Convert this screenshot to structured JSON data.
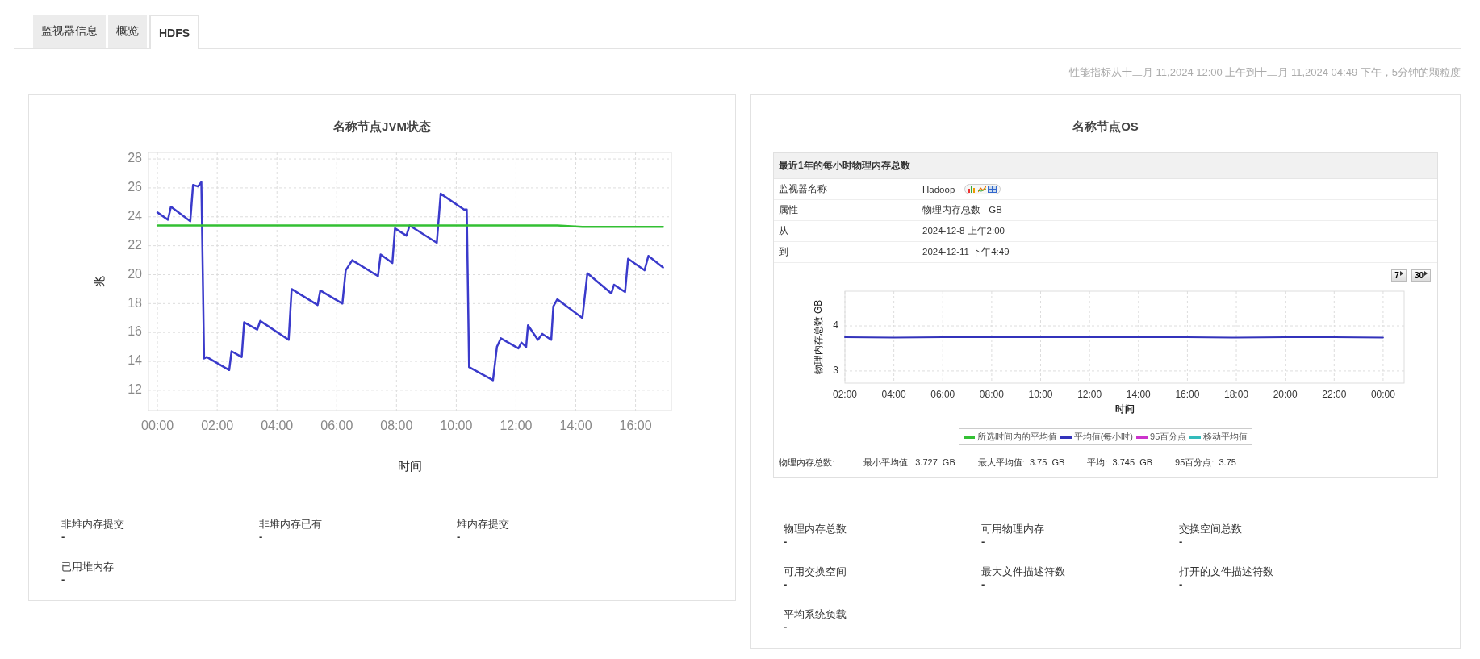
{
  "tabs": [
    {
      "label": "监视器信息",
      "selected": false
    },
    {
      "label": "概览",
      "selected": false
    },
    {
      "label": "HDFS",
      "selected": true
    }
  ],
  "period_note": "性能指标从十二月 11,2024 12:00 上午到十二月 11,2024 04:49 下午，5分钟的颗粒度",
  "jvm_panel": {
    "title": "名称节点JVM状态",
    "chart_data": {
      "type": "line",
      "xlabel": "时间",
      "ylabel": "兆",
      "x": [
        0,
        0.35,
        0.45,
        1.1,
        1.19,
        1.36,
        1.47,
        1.56,
        1.65,
        2.4,
        2.48,
        2.82,
        2.9,
        3.34,
        3.44,
        4.39,
        4.49,
        5.36,
        5.45,
        6.19,
        6.3,
        6.52,
        7.38,
        7.47,
        7.86,
        7.95,
        8.33,
        8.44,
        9.35,
        9.48,
        10.26,
        10.35,
        10.43,
        11.23,
        11.36,
        11.49,
        12.08,
        12.18,
        12.34,
        12.4,
        12.73,
        12.88,
        13.18,
        13.25,
        13.38,
        14.22,
        14.39,
        15.19,
        15.28,
        15.65,
        15.75,
        16.3,
        16.43,
        16.92
      ],
      "series": [
        {
          "color": "#3a3acb",
          "values": [
            24.3,
            23.8,
            24.7,
            23.7,
            26.2,
            26.1,
            26.4,
            14.2,
            14.3,
            13.4,
            14.7,
            14.3,
            16.7,
            16.2,
            16.8,
            15.5,
            19.0,
            17.9,
            18.9,
            18.0,
            20.3,
            21.0,
            19.9,
            21.4,
            20.8,
            23.2,
            22.7,
            23.4,
            22.2,
            25.6,
            24.5,
            24.5,
            13.6,
            12.7,
            15.0,
            15.6,
            14.9,
            15.3,
            15.0,
            16.5,
            15.5,
            15.9,
            15.5,
            17.8,
            18.3,
            17.0,
            20.1,
            18.7,
            19.3,
            18.8,
            21.1,
            20.3,
            21.3,
            20.5
          ]
        },
        {
          "color": "#33c033",
          "values": [
            23.4,
            23.4,
            23.4,
            23.4,
            23.4,
            23.4,
            23.4,
            23.4,
            23.4,
            23.4,
            23.4,
            23.4,
            23.4,
            23.4,
            23.4,
            23.4,
            23.4,
            23.4,
            23.4,
            23.4,
            23.4,
            23.4,
            23.4,
            23.4,
            23.4,
            23.4,
            23.4,
            23.4,
            23.4,
            23.4,
            23.4,
            23.4,
            23.4,
            23.4,
            23.4,
            23.4,
            23.4,
            23.4,
            23.4,
            23.4,
            23.4,
            23.4,
            23.4,
            23.4,
            23.4,
            23.3,
            23.3,
            23.3,
            23.3,
            23.3,
            23.3,
            23.3,
            23.3,
            23.3
          ]
        }
      ],
      "xlim": [
        -0.3,
        17.2
      ],
      "ylim": [
        10.6,
        28.45
      ],
      "xticks": [
        {
          "value": 0,
          "label": "00:00"
        },
        {
          "value": 2,
          "label": "02:00"
        },
        {
          "value": 4,
          "label": "04:00"
        },
        {
          "value": 6,
          "label": "06:00"
        },
        {
          "value": 8,
          "label": "08:00"
        },
        {
          "value": 10,
          "label": "10:00"
        },
        {
          "value": 12,
          "label": "12:00"
        },
        {
          "value": 14,
          "label": "14:00"
        },
        {
          "value": 16,
          "label": "16:00"
        }
      ],
      "yticks": [
        12,
        14,
        16,
        18,
        20,
        22,
        24,
        26,
        28
      ],
      "grid": true
    },
    "metrics": [
      {
        "label": "非堆内存提交",
        "value": "-"
      },
      {
        "label": "非堆内存已有",
        "value": "-"
      },
      {
        "label": "堆内存提交",
        "value": "-"
      },
      {
        "label": "已用堆内存",
        "value": "-"
      }
    ]
  },
  "os_panel": {
    "title": "名称节点OS",
    "report": {
      "header": "最近1年的每小时物理内存总数",
      "rows": [
        {
          "label": "监视器名称",
          "value": "Hadoop",
          "kind": "monitor"
        },
        {
          "label": "属性",
          "value": "物理内存总数 - GB",
          "kind": "text"
        },
        {
          "label": "从",
          "value": "2024-12-8 上午2:00",
          "kind": "text"
        },
        {
          "label": "到",
          "value": "2024-12-11 下午4:49",
          "kind": "text"
        }
      ],
      "range_buttons": [
        "7",
        "30"
      ],
      "chart_data": {
        "type": "line",
        "xlabel": "时间",
        "ylabel": "物理内存总数 GB",
        "categories": [
          "02:00",
          "04:00",
          "06:00",
          "08:00",
          "10:00",
          "12:00",
          "14:00",
          "16:00",
          "18:00",
          "20:00",
          "22:00",
          "00:00"
        ],
        "series": [
          {
            "name": "所选时间内的平均值",
            "color": "#33c033",
            "values": [
              null,
              null,
              null,
              null,
              null,
              null,
              null,
              null,
              null,
              null,
              null,
              null
            ]
          },
          {
            "name": "平均值(每小时)",
            "color": "#3333bb",
            "values": [
              3.75,
              3.74,
              3.75,
              3.75,
              3.75,
              3.75,
              3.75,
              3.75,
              3.74,
              3.75,
              3.75,
              3.74
            ]
          },
          {
            "name": "95百分点",
            "color": "#cc33cc",
            "values": [
              null,
              null,
              null,
              null,
              null,
              null,
              null,
              null,
              null,
              null,
              null,
              null
            ]
          },
          {
            "name": "移动平均值",
            "color": "#33bbbb",
            "values": [
              null,
              null,
              null,
              null,
              null,
              null,
              null,
              null,
              null,
              null,
              null,
              null
            ]
          }
        ],
        "ylim": [
          2.73,
          4.77
        ],
        "yticks": [
          3,
          4
        ],
        "grid": true
      },
      "stats_label": "物理内存总数:",
      "stats": [
        {
          "label": "最小平均值:",
          "value": "3.727  GB"
        },
        {
          "label": "最大平均值:",
          "value": "3.75  GB"
        },
        {
          "label": "平均:",
          "value": "3.745  GB"
        },
        {
          "label": "95百分点:",
          "value": "3.75"
        }
      ]
    },
    "metrics": [
      {
        "label": "物理内存总数",
        "value": "-"
      },
      {
        "label": "可用物理内存",
        "value": "-"
      },
      {
        "label": "交换空间总数",
        "value": "-"
      },
      {
        "label": "可用交换空间",
        "value": "-"
      },
      {
        "label": "最大文件描述符数",
        "value": "-"
      },
      {
        "label": "打开的文件描述符数",
        "value": "-"
      },
      {
        "label": "平均系统负载",
        "value": "-"
      }
    ]
  }
}
